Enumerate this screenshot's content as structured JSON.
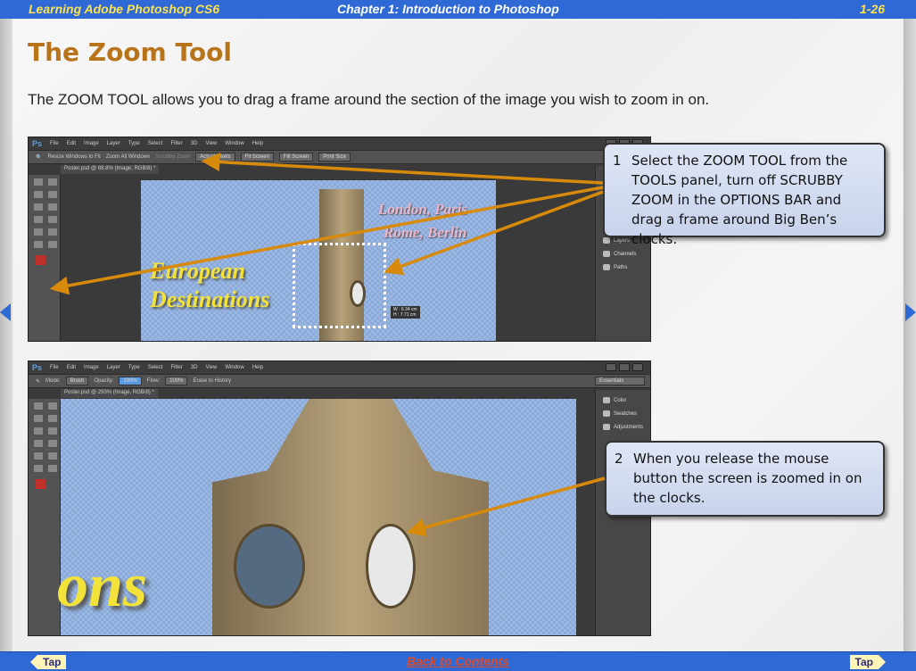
{
  "header": {
    "book": "Learning Adobe Photoshop CS6",
    "chapter": "Chapter 1: Introduction to Photoshop",
    "page": "1-26"
  },
  "title": "The Zoom Tool",
  "intro": "The ZOOM TOOL allows you to drag a frame around the section of the image you wish to zoom in on.",
  "ps_menu": [
    "File",
    "Edit",
    "Image",
    "Layer",
    "Type",
    "Select",
    "Filter",
    "3D",
    "View",
    "Window",
    "Help"
  ],
  "ps_logo": "Ps",
  "shot1": {
    "options": [
      "Resize Windows to Fit",
      "Zoom All Windows",
      "Scrubby Zoom"
    ],
    "buttons": [
      "Actual Pixels",
      "Fit Screen",
      "Fill Screen",
      "Print Size"
    ],
    "tab": "Poster.psd @ 88.8% (Image, RGB/8) *",
    "panels": [
      "Layers",
      "Channels",
      "Paths"
    ],
    "image_text_1": "London, Paris",
    "image_text_2": "Rome, Berlin",
    "image_title_1": "European",
    "image_title_2": "Destinations",
    "readout_w": "W : 6.34 cm",
    "readout_h": "H : 7.71 cm"
  },
  "shot2": {
    "mode_label": "Mode:",
    "mode": "Brush",
    "opacity_label": "Opacity:",
    "opacity": "100%",
    "flow_label": "Flow:",
    "flow": "100%",
    "erase": "Erase to History",
    "workspace": "Essentials",
    "tab": "Poster.psd @ 293% (Image, RGB/8) *",
    "panels": [
      "Color",
      "Swatches",
      "Adjustments"
    ],
    "image_title": "ons"
  },
  "callouts": [
    {
      "num": "1",
      "text": "Select the ZOOM TOOL from the TOOLS panel, turn off SCRUBBY ZOOM in the OPTIONS BAR and drag a frame around Big Ben’s clocks."
    },
    {
      "num": "2",
      "text": "When you release the mouse button the screen is zoomed in on the clocks."
    }
  ],
  "footer": {
    "prev": "Tap",
    "contents": "Back to Contents",
    "next": "Tap"
  },
  "colors": {
    "bar": "#2f69d6",
    "title": "#b8741a",
    "arrow": "#d88a0a",
    "link": "#e04a22"
  }
}
